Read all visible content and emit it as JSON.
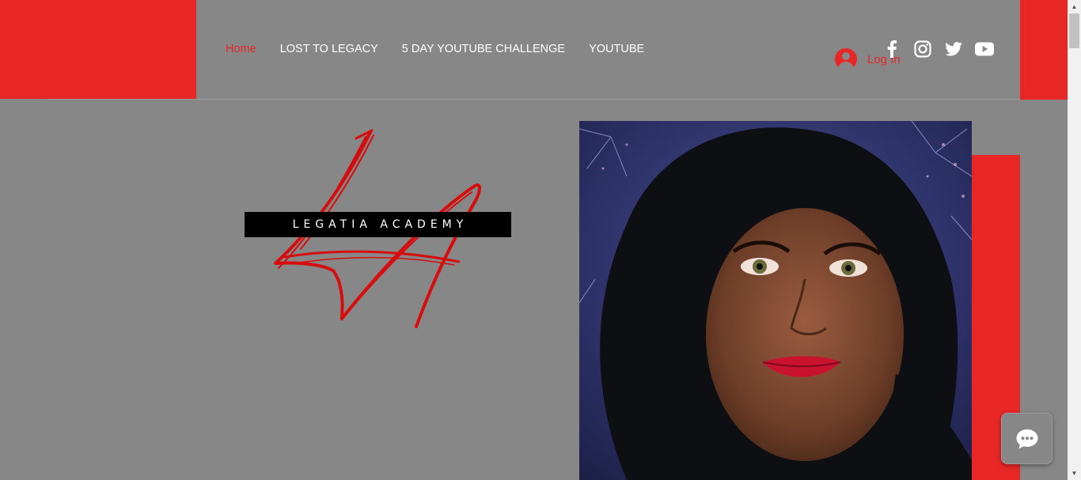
{
  "nav": {
    "items": [
      {
        "label": "Home",
        "active": true
      },
      {
        "label": "LOST TO LEGACY",
        "active": false
      },
      {
        "label": "5 DAY YOUTUBE CHALLENGE",
        "active": false
      },
      {
        "label": "YOUTUBE",
        "active": false
      }
    ]
  },
  "login": {
    "label": "Log In",
    "icon": "user-avatar-icon"
  },
  "social": [
    "facebook-icon",
    "instagram-icon",
    "twitter-icon",
    "youtube-icon"
  ],
  "logo": {
    "text": "LEGATIA ACADEMY",
    "monogram": "LA"
  },
  "photo": {
    "alt": "portrait-photo"
  },
  "chat": {
    "icon": "chat-bubble-icon"
  },
  "colors": {
    "accent": "#e82626",
    "background": "#878787",
    "bar": "#000000",
    "text": "#ffffff"
  }
}
